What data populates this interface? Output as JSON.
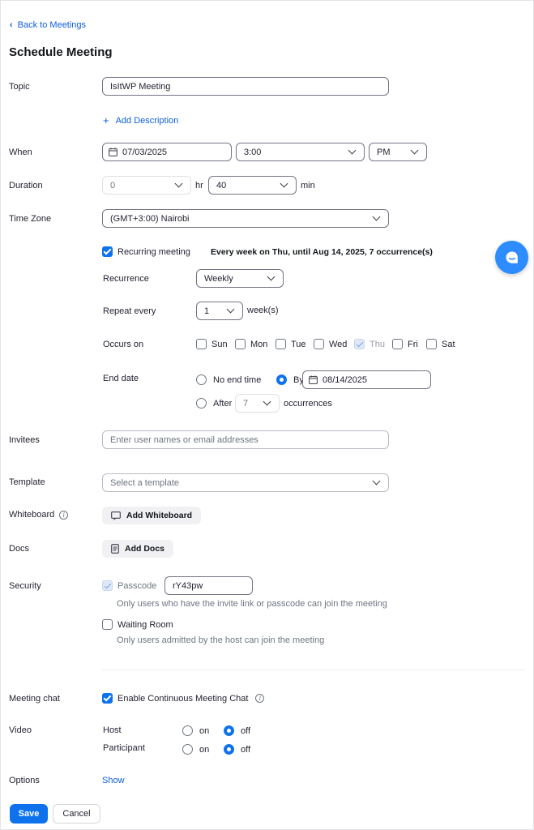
{
  "nav": {
    "back_label": "Back to Meetings"
  },
  "page": {
    "title": "Schedule Meeting"
  },
  "labels": {
    "topic": "Topic",
    "when": "When",
    "duration": "Duration",
    "time_zone": "Time Zone",
    "invitees": "Invitees",
    "template": "Template",
    "whiteboard": "Whiteboard",
    "docs": "Docs",
    "security": "Security",
    "meeting_chat": "Meeting chat",
    "video": "Video",
    "options": "Options"
  },
  "topic": {
    "value": "IsItWP Meeting",
    "add_description": "Add Description"
  },
  "when": {
    "date": "07/03/2025",
    "time": "3:00",
    "ampm": "PM"
  },
  "duration": {
    "hours": "0",
    "hr_label": "hr",
    "minutes": "40",
    "min_label": "min"
  },
  "time_zone": {
    "value": "(GMT+3:00) Nairobi"
  },
  "recurring": {
    "label": "Recurring meeting",
    "checked": true,
    "summary": "Every week on Thu, until Aug 14, 2025, 7 occurrence(s)",
    "recurrence_label": "Recurrence",
    "recurrence_value": "Weekly",
    "repeat_label": "Repeat every",
    "repeat_value": "1",
    "repeat_unit": "week(s)",
    "occurs_label": "Occurs on",
    "days": [
      "Sun",
      "Mon",
      "Tue",
      "Wed",
      "Thu",
      "Fri",
      "Sat"
    ],
    "end_label": "End date",
    "no_end": "No end time",
    "by_label": "By",
    "by_date": "08/14/2025",
    "after_label": "After",
    "after_value": "7",
    "occurrences_label": "occurrences"
  },
  "invitees": {
    "placeholder": "Enter user names or email addresses"
  },
  "template": {
    "placeholder": "Select a template"
  },
  "whiteboard": {
    "button": "Add Whiteboard"
  },
  "docs": {
    "button": "Add Docs"
  },
  "security": {
    "passcode_label": "Passcode",
    "passcode_value": "rY43pw",
    "passcode_hint": "Only users who have the invite link or passcode can join the meeting",
    "waiting_room_label": "Waiting Room",
    "waiting_room_hint": "Only users admitted by the host can join the meeting"
  },
  "meeting_chat": {
    "label": "Enable Continuous Meeting Chat"
  },
  "video": {
    "host_label": "Host",
    "participant_label": "Participant",
    "on_label": "on",
    "off_label": "off"
  },
  "options": {
    "show_label": "Show"
  },
  "actions": {
    "save": "Save",
    "cancel": "Cancel"
  },
  "colors": {
    "accent": "#0e72ed",
    "link": "#0e5fd8",
    "fab": "#2d8cff"
  }
}
